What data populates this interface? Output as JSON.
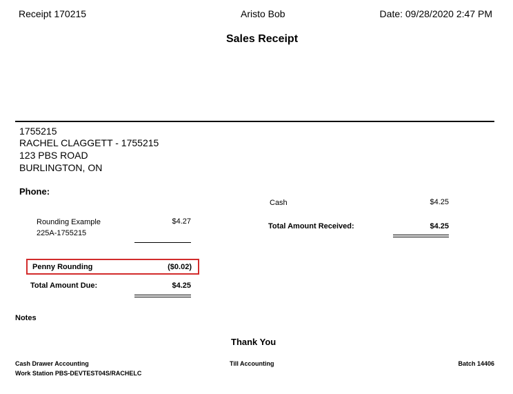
{
  "header": {
    "receipt_number": "Receipt 170215",
    "user": "Aristo Bob",
    "date": "Date: 09/28/2020 2:47 PM"
  },
  "title": "Sales Receipt",
  "customer": {
    "id": "1755215",
    "name": "RACHEL CLAGGETT - 1755215",
    "address1": "123 PBS ROAD",
    "address2": "BURLINGTON, ON"
  },
  "phone_label": "Phone:",
  "items": [
    {
      "description": "Rounding Example",
      "code": "225A-1755215",
      "amount": "$4.27"
    }
  ],
  "penny_rounding": {
    "label": "Penny Rounding",
    "amount": "($0.02)"
  },
  "total_due": {
    "label": "Total Amount Due:",
    "amount": "$4.25"
  },
  "payments": [
    {
      "method": "Cash",
      "amount": "$4.25"
    }
  ],
  "total_received": {
    "label": "Total Amount Received:",
    "amount": "$4.25"
  },
  "notes_label": "Notes",
  "thank_you": "Thank You",
  "footer": {
    "cash_drawer": "Cash Drawer Accounting",
    "till": "Till Accounting",
    "batch": "Batch 14406",
    "workstation": "Work Station PBS-DEVTEST04S/RACHELC"
  }
}
